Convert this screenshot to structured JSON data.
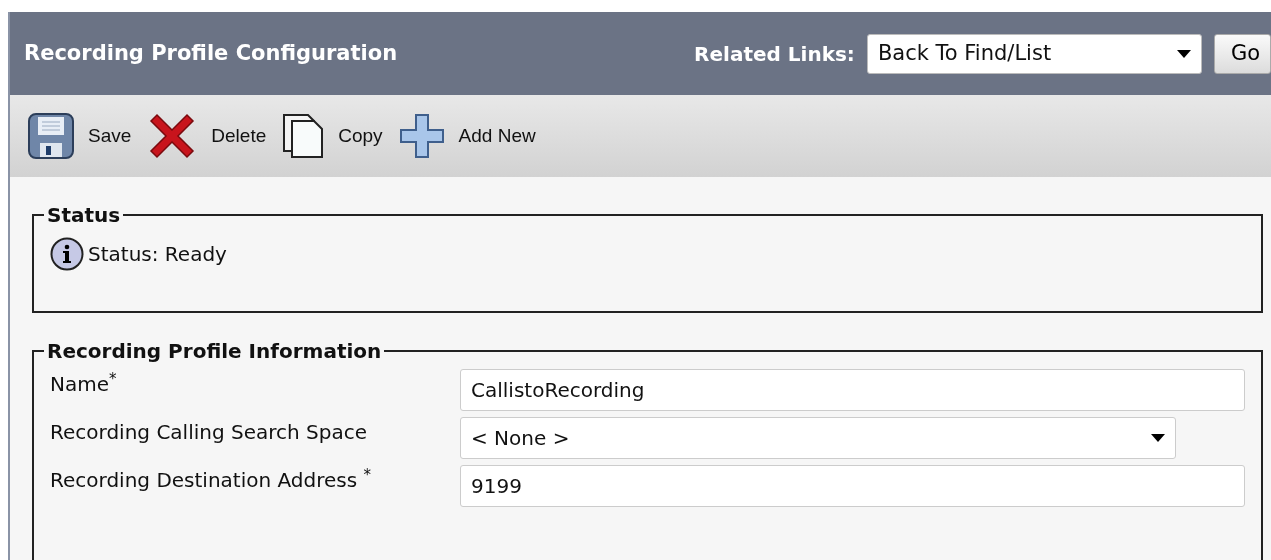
{
  "header": {
    "title": "Recording Profile Configuration",
    "related_links_label": "Related Links:",
    "related_links_value": "Back To Find/List",
    "go_button": "Go"
  },
  "toolbar": [
    {
      "kind": "save",
      "label": "Save"
    },
    {
      "kind": "delete",
      "label": "Delete"
    },
    {
      "kind": "copy",
      "label": "Copy"
    },
    {
      "kind": "add",
      "label": "Add New"
    }
  ],
  "status": {
    "legend": "Status",
    "message": "Status: Ready"
  },
  "info": {
    "legend": "Recording Profile Information",
    "fields": [
      {
        "kind": "text",
        "label": "Name$^{*}$",
        "value": "CallistoRecording"
      },
      {
        "kind": "select",
        "label": "Recording Calling Search Space",
        "value": "< None >"
      },
      {
        "kind": "text",
        "label": "Recording Destination Address $^{*}$",
        "value": "9199"
      }
    ]
  }
}
